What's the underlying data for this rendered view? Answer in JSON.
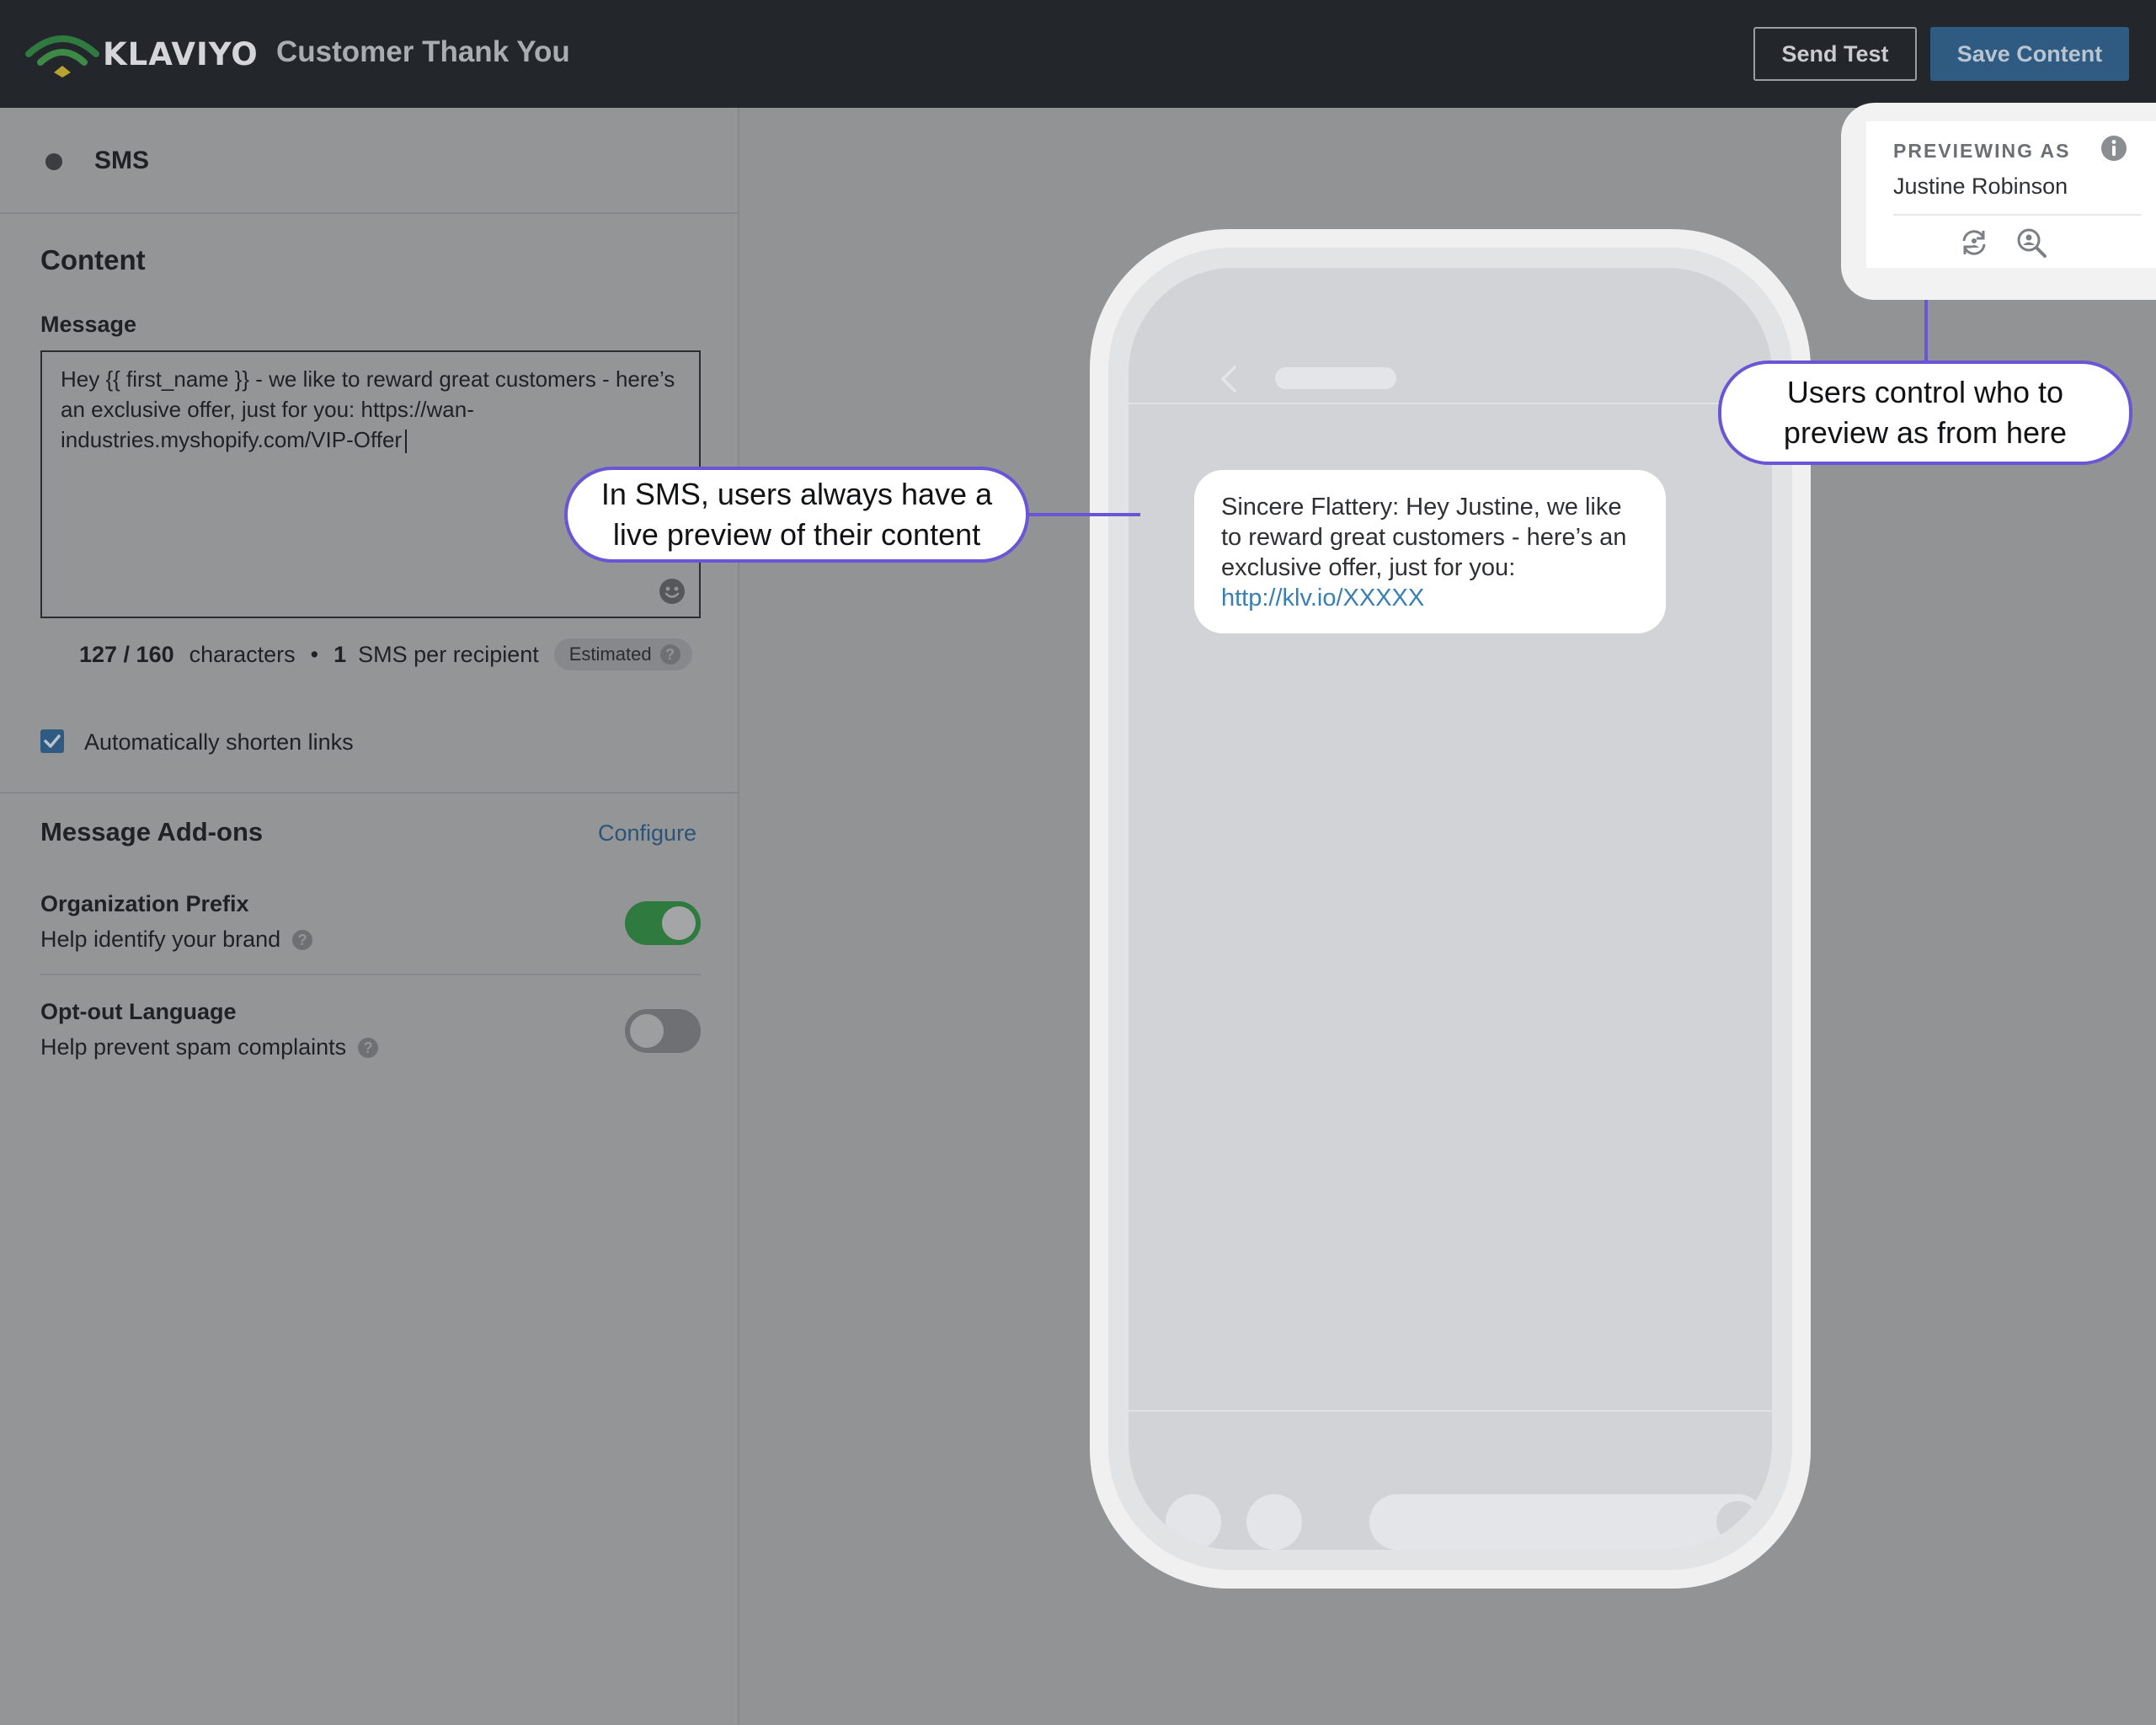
{
  "header": {
    "logo_text": "KLAVIYO",
    "doc_title": "Customer Thank You",
    "send_test_label": "Send Test",
    "save_content_label": "Save Content"
  },
  "channel": {
    "label": "SMS"
  },
  "content": {
    "section_title": "Content",
    "message_label": "Message",
    "message_value": "Hey {{ first_name }} - we like to reward great customers - here’s an exclusive offer, just for you: https://wan-industries.myshopify.com/VIP-Offer",
    "char_count": "127 / 160",
    "char_label": "characters",
    "sms_count": "1",
    "sms_label": "SMS per recipient",
    "estimated_label": "Estimated",
    "shorten_links_label": "Automatically shorten links",
    "shorten_links_checked": true
  },
  "addons": {
    "section_title": "Message Add-ons",
    "configure_label": "Configure",
    "items": [
      {
        "title": "Organization Prefix",
        "subtitle": "Help identify your brand",
        "enabled": true
      },
      {
        "title": "Opt-out Language",
        "subtitle": "Help prevent spam complaints",
        "enabled": false
      }
    ]
  },
  "preview": {
    "label": "PREVIEWING AS",
    "name": "Justine Robinson",
    "bubble_text": "Sincere Flattery: Hey Justine, we like to reward great customers - here’s an exclusive offer, just for you:",
    "bubble_link": "http://klv.io/XXXXX"
  },
  "callouts": {
    "live_preview": "In SMS, users always have a live preview of their content",
    "preview_as": "Users control who to preview as from here"
  },
  "colors": {
    "accent_blue": "#2f5a82",
    "toggle_on": "#2f7a3e",
    "callout_border": "#6a55d6",
    "link": "#3a7fb1"
  },
  "icons": [
    "klaviyo-logo-icon",
    "smile-icon",
    "help-icon",
    "check-icon",
    "back-chevron-icon",
    "info-icon",
    "refresh-icon",
    "lookup-icon"
  ]
}
